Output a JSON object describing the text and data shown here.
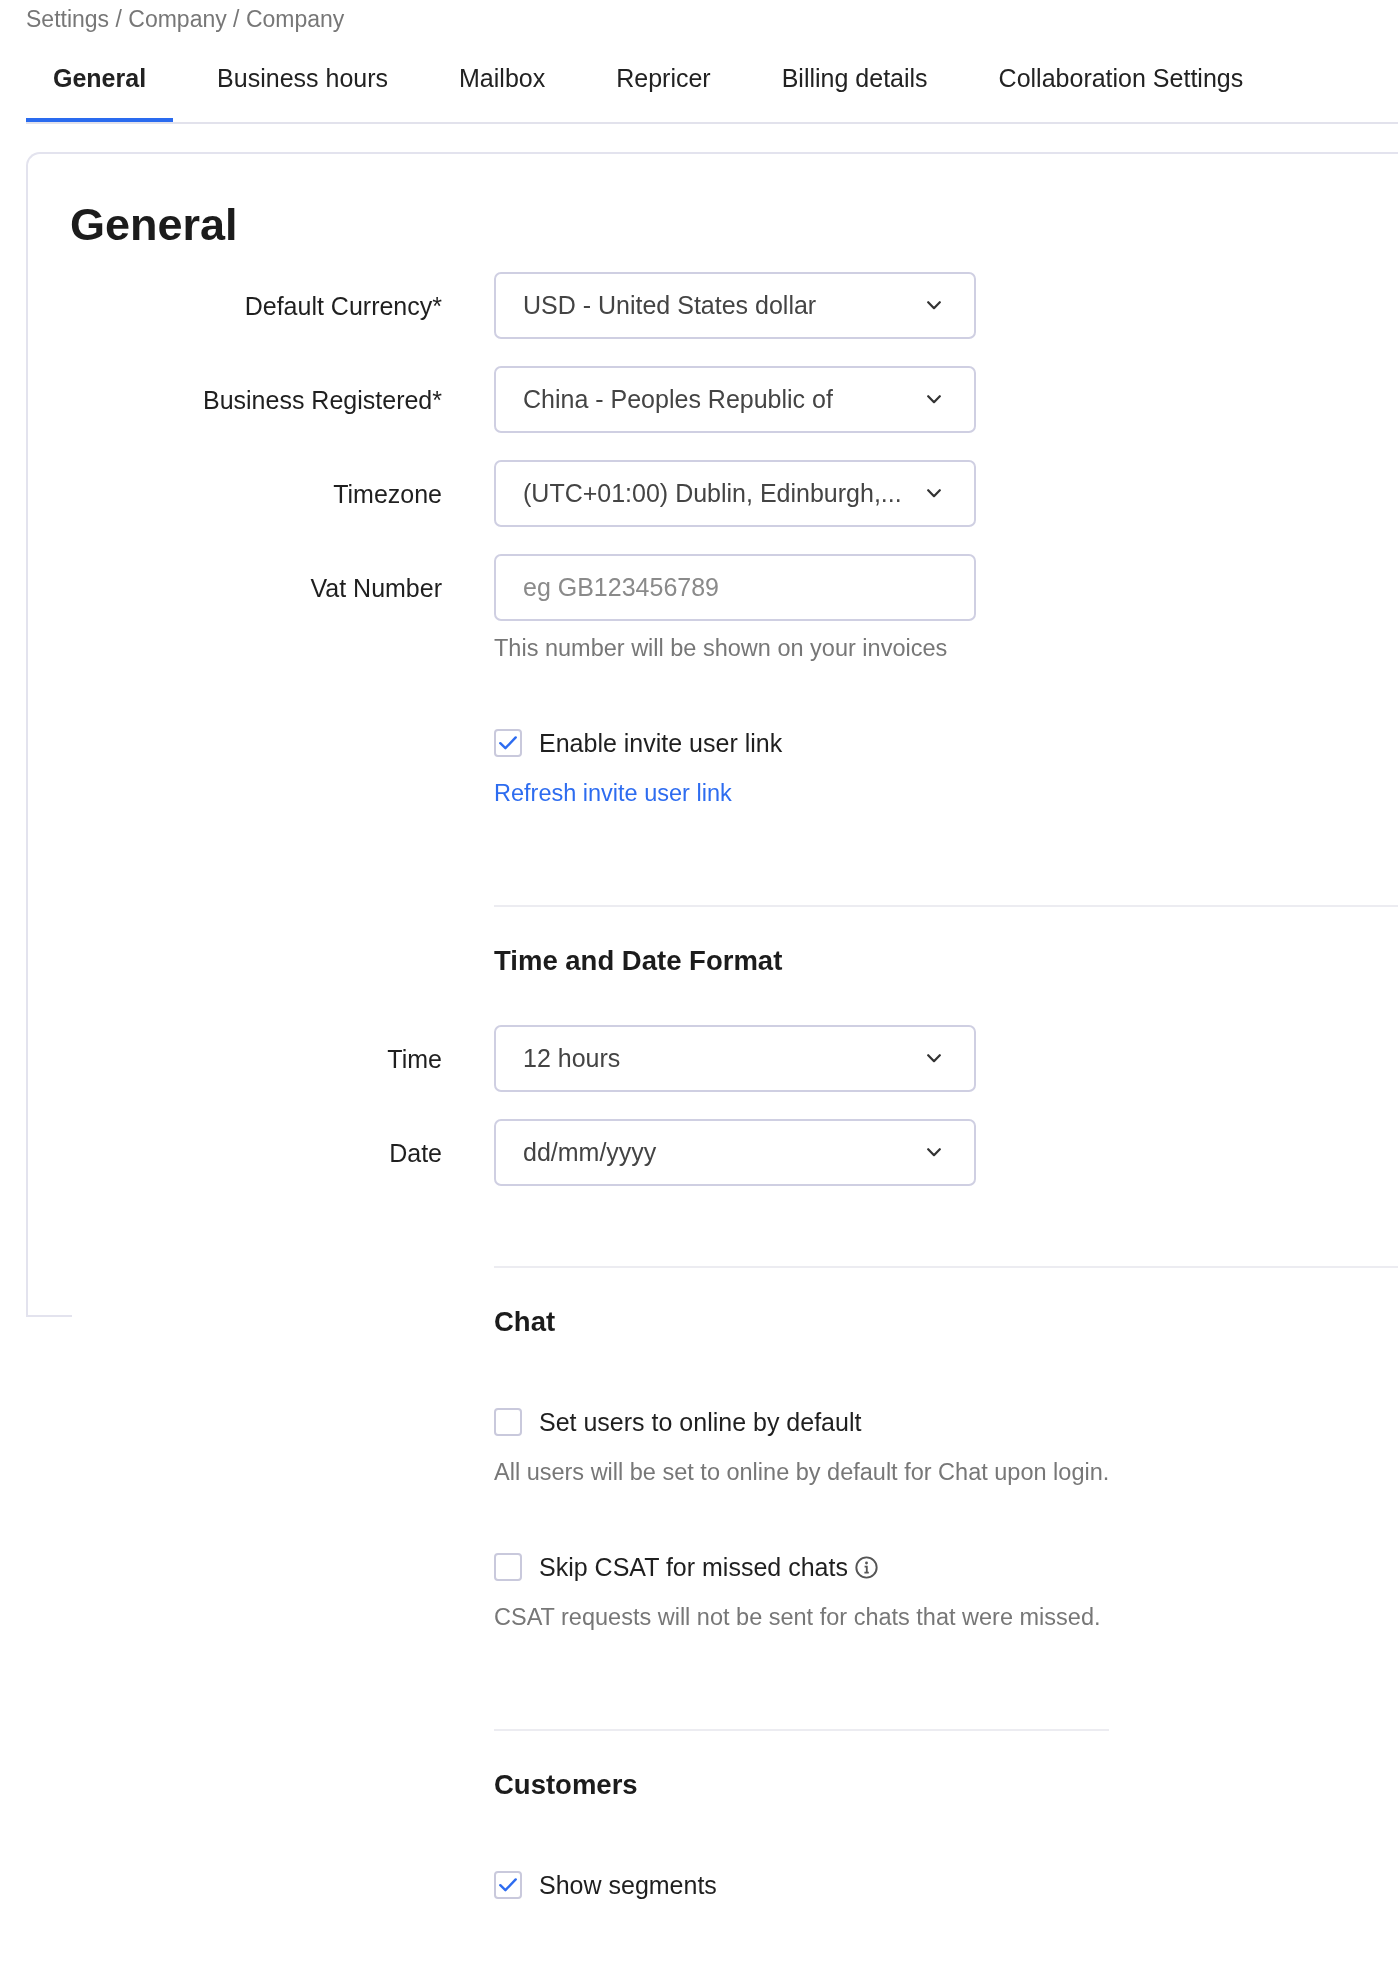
{
  "breadcrumb": "Settings / Company / Company",
  "tabs": [
    {
      "label": "General",
      "selected": true
    },
    {
      "label": "Business hours",
      "selected": false
    },
    {
      "label": "Mailbox",
      "selected": false
    },
    {
      "label": "Repricer",
      "selected": false
    },
    {
      "label": "Billing details",
      "selected": false
    },
    {
      "label": "Collaboration Settings",
      "selected": false
    }
  ],
  "page_title": "General",
  "general_fields": [
    {
      "label": "Default Currency*",
      "kind": "select",
      "value": "USD - United States dollar"
    },
    {
      "label": "Business Registered*",
      "kind": "select",
      "value": "China - Peoples Republic of"
    },
    {
      "label": "Timezone",
      "kind": "select",
      "value": "(UTC+01:00) Dublin, Edinburgh,..."
    },
    {
      "label": "Vat Number",
      "kind": "text",
      "placeholder": "eg GB123456789",
      "hint": "This number will be shown on your invoices"
    }
  ],
  "invite": {
    "checkbox": {
      "label": "Enable invite user link",
      "checked": true
    },
    "link": "Refresh invite user link"
  },
  "sections": [
    {
      "title": "Time and Date Format",
      "kind": "fields",
      "fields": [
        {
          "label": "Time",
          "kind": "select",
          "value": "12 hours"
        },
        {
          "label": "Date",
          "kind": "select",
          "value": "dd/mm/yyyy"
        }
      ]
    },
    {
      "title": "Chat",
      "kind": "options",
      "options": [
        {
          "label": "Set users to online by default",
          "checked": false,
          "hint": "All users will be set to online by default for Chat upon login."
        },
        {
          "label": "Skip CSAT for missed chats",
          "checked": false,
          "info": true,
          "hint": "CSAT requests will not be sent for chats that were missed."
        }
      ]
    },
    {
      "title": "Customers",
      "kind": "options",
      "options": [
        {
          "label": "Show segments",
          "checked": true
        }
      ]
    }
  ]
}
